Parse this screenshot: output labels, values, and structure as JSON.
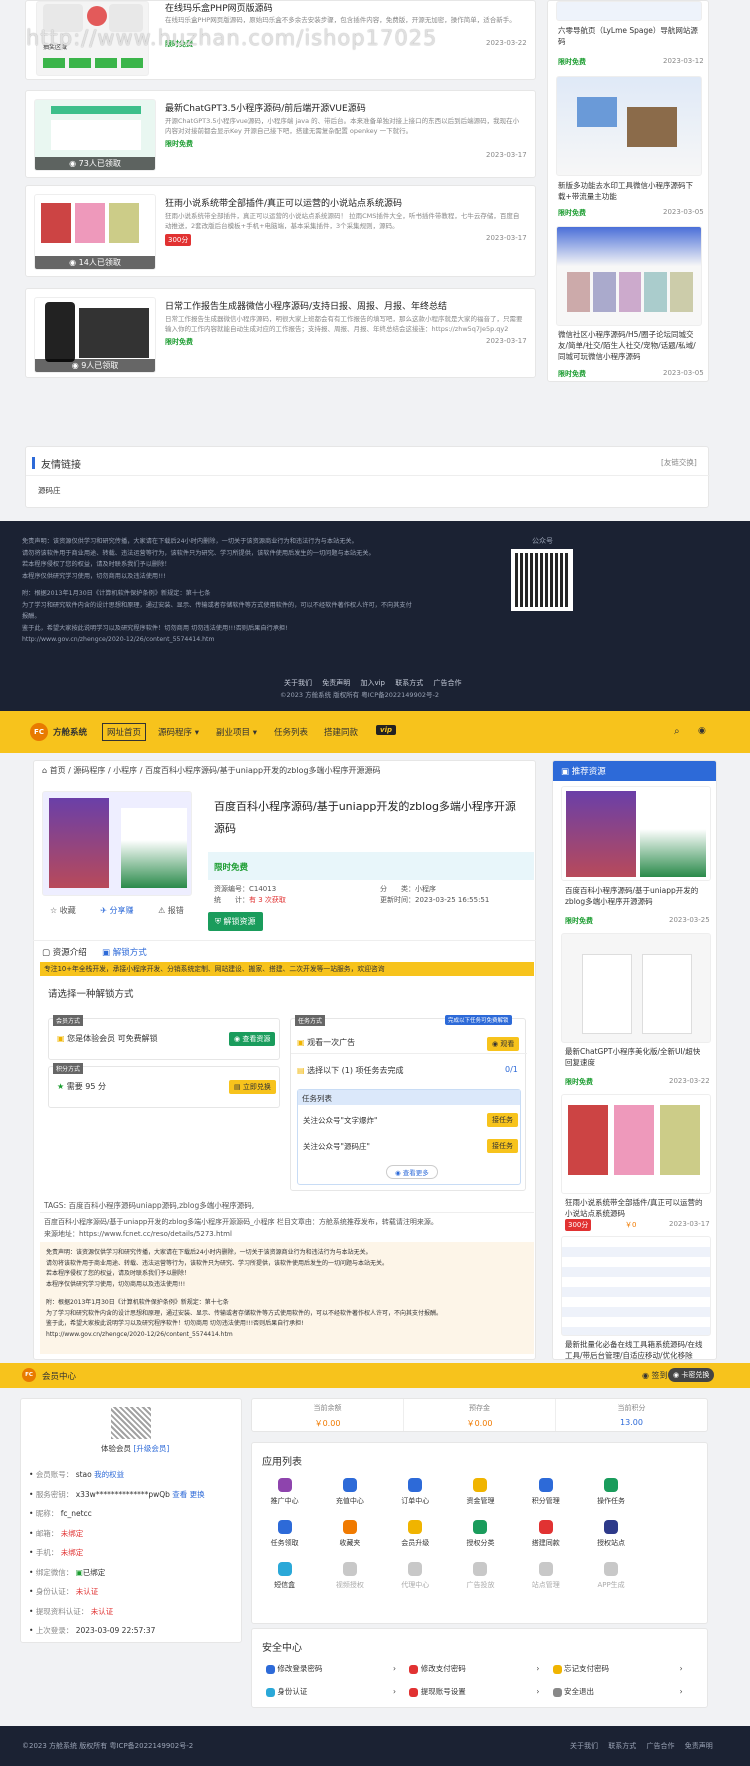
{
  "watermark": "http://www.huzhan.com/ishop17025",
  "top_list": [
    {
      "title": "在线玛乐盒PHP网页版源码",
      "desc": "在线玛乐盒PHP网页版源码，原始玛乐盒不多余去安装步骤，包含插件内容，免费版，开源无加密，操作简单，适合新手。",
      "price": "限时免费",
      "date": "2023-03-22",
      "count": "",
      "thumb_badge": "抽奖区域"
    },
    {
      "title": "最新ChatGPT3.5小程序源码/前后端开源VUE源码",
      "desc": "开源ChatGPT3.5小程序vue源码，小程序端 java 的、带后台。本来准备单独对接上接口的东西以后到后端源码，我现在小内容对对接前都会显示Key 开源自己接下吧，搭建无需复杂配置 openkey 一下就行。",
      "price": "限时免费",
      "date": "2023-03-17",
      "count": "73人已领取"
    },
    {
      "title": "狂雨小说系统带全部插件/真正可以运营的小说站点系统源码",
      "desc": "狂雨小说系统带全部插件，真正可以运营的小说站点系统源码！ 拉雨CMS插件大全，听书插件带教程，七牛云存储，百度自动推送，2套改版后台模板+手机+电脑端，基本采集插件，3个采集规则，源码。",
      "price": "300分",
      "date": "2023-03-17",
      "count": "14人已领取"
    },
    {
      "title": "日常工作报告生成器微信小程序源码/支持日报、周报、月报、年终总结",
      "desc": "日常工作报告生成器微信小程序源码，明很大家上班都会有有工作报告的填写吧，那么这款小程序就是大家的福音了，只需要输入你的工作内容就能自动生成对应的工作报告；支持报、周报、月报、年终总结会这接连：https://zhw5q7Je5p.qy2",
      "price": "限时免费",
      "date": "2023-03-17",
      "count": "9人已领取"
    }
  ],
  "right_list": [
    {
      "title": "六零导航页（LyLme Spage）导航网站源码",
      "price": "限时免费",
      "date": "2023-03-12"
    },
    {
      "title": "新版多功能去水印工具微信小程序源码下载+带流量主功能",
      "price": "限时免费",
      "date": "2023-03-05"
    },
    {
      "title": "微信社区小程序源码/H5/圈子论坛同城交友/简单/社交/陌生人社交/宠物/话题/私域/同城可玩微信小程序源码",
      "price": "限时免费",
      "date": "2023-03-05"
    }
  ],
  "friend_links": {
    "title": "友情链接",
    "more": "[友链交换]",
    "items": [
      "源码庄"
    ]
  },
  "footer1": {
    "disclaimer": [
      "免责声明：该资源仅供学习和研究传播，大家请在下载后24小时内删除，一切关于该资源商业行为和违法行为与本站无关。",
      "请勿将该软件用于商业用途、转载、违法运营等行为，该软件只为研究、学习所提供，该软件使用后发生的一切问题与本站无关。",
      "若本程序侵权了您的权益，请及时联系我们予以删除！",
      "本程序仅供研究学习使用，切勿商用以及违法使用!!!",
      "附：根据2013年1月30日《计算机软件保护条例》新规定：第十七条",
      "为了学习和研究软件内含的设计思想和原理，通过安装、显示、传输或者存储软件等方式使用软件的，可以不经软件著作权人许可，不向其支付报酬。",
      "鉴于此，希望大家按此说明学习以及研究程序软件！切勿商用 切勿违法使用!!!否则后果自行承担!",
      "http://www.gov.cn/zhengce/2020-12/26/content_5574414.htm"
    ],
    "qr_label": "公众号",
    "links": [
      "关于我们",
      "免责声明",
      "加入vip",
      "联系方式",
      "广告合作"
    ],
    "copyright": "©2023  方舱系统  版权所有  粤ICP备2022149902号-2"
  },
  "header": {
    "logo_text": "方舱系统",
    "nav": [
      "网址首页",
      "源码程序",
      "副业项目",
      "任务列表",
      "搭建同款"
    ],
    "vip": "vip"
  },
  "breadcrumb": "首页 / 源码程序 / 小程序 / 百度百科小程序源码/基于uniapp开发的zblog多端小程序开源源码",
  "product": {
    "title": "百度百科小程序源码/基于uniapp开发的zblog多端小程序开源源码",
    "price": "限时免费",
    "code_label": "资源编号：",
    "code": "C14013",
    "cat_label": "分　　类：",
    "cat": "小程序",
    "stat_label": "统　　计：",
    "stat": "有 3 次获取",
    "update_label": "更新时间：",
    "update": "2023-03-25 16:55:51",
    "fav": "收藏",
    "share": "分享赚",
    "report": "报错",
    "unlock": "解锁资源"
  },
  "tabs": [
    "资源介绍",
    "解锁方式"
  ],
  "notice_bar": "专注10+年全栈开发，承接小程序开发、分销系统定制、网站建设、搬家、搭建、二次开发等一站服务，欢迎咨询",
  "unlock": {
    "heading": "请选择一种解锁方式",
    "member_tag": "会员方式",
    "member_text": "您是体验会员 可免费解锁",
    "member_btn": "查看资源",
    "points_tag": "积分方式",
    "points_text": "需要 95 分",
    "points_btn": "立即兑换",
    "task_tag": "任务方式",
    "task_badge": "完成以下任务可免费解锁",
    "ad_text": "观看一次广告",
    "ad_btn": "观看",
    "choose_text": "选择以下 (1) 项任务去完成",
    "choose_count": "0/1",
    "task_list_title": "任务列表",
    "tasks": [
      {
        "text": "关注公众号\"文字爆炸\"",
        "btn": "接任务"
      },
      {
        "text": "关注公众号\"源码庄\"",
        "btn": "接任务"
      }
    ],
    "more": "查看更多"
  },
  "tags": "TAGS:  百度百科小程序源码uniapp源码,zblog多端小程序源码,",
  "source_line": "百度百科小程序源码/基于uniapp开发的zblog多端小程序开源源码_小程序 栏目文章由：方舱系统推荐发布，转载请注明来源。",
  "source_url": "来源地址：https://www.fcnet.cc/reso/details/5273.html",
  "sidebar_rec": {
    "title": "推荐资源",
    "items": [
      {
        "title": "百度百科小程序源码/基于uniapp开发的zblog多端小程序开源源码",
        "price": "限时免费",
        "date": "2023-03-25"
      },
      {
        "title": "最新ChatGPT小程序美化版/全新UI/超快回复速度",
        "price": "限时免费",
        "date": "2023-03-22"
      },
      {
        "title": "狂雨小说系统带全部插件/真正可以运营的小说站点系统源码",
        "price": "300分",
        "price2": "￥0",
        "date": "2023-03-17"
      },
      {
        "title": "最新批量化必备在线工具箱系统源码/在线工具/带后台管理/自适应移动/优化移除",
        "price": "",
        "date": ""
      }
    ]
  },
  "member": {
    "title": "会员中心",
    "sign": "签到",
    "redeem": "卡密兑换",
    "level": "体验会员",
    "upgrade": "[升级会员]",
    "fields": [
      {
        "k": "会员账号：",
        "v": "stao",
        "link": "我的权益"
      },
      {
        "k": "服务密钥：",
        "v": "x33w**************pwQb",
        "link": "查看 更换"
      },
      {
        "k": "昵称：",
        "v": "fc_netcc",
        "link": ""
      },
      {
        "k": "邮箱：",
        "v": "未绑定",
        "link": ""
      },
      {
        "k": "手机：",
        "v": "未绑定",
        "link": ""
      },
      {
        "k": "绑定微信：",
        "v": "已绑定",
        "link": ""
      },
      {
        "k": "身份认证：",
        "v": "未认证",
        "link": ""
      },
      {
        "k": "提现资料认证：",
        "v": "未认证",
        "link": ""
      },
      {
        "k": "上次登录：",
        "v": "2023-03-09 22:57:37",
        "link": ""
      }
    ],
    "stats": [
      {
        "k": "当前余额",
        "v": "￥0.00"
      },
      {
        "k": "预存金",
        "v": "￥0.00"
      },
      {
        "k": "当前积分",
        "v": "13.00"
      }
    ],
    "apps_title": "应用列表",
    "apps": [
      {
        "label": "推广中心",
        "color": "#8e44ad"
      },
      {
        "label": "充值中心",
        "color": "#2d6ad8"
      },
      {
        "label": "订单中心",
        "color": "#2d6ad8"
      },
      {
        "label": "资金管理",
        "color": "#f0b400"
      },
      {
        "label": "积分管理",
        "color": "#2d6ad8"
      },
      {
        "label": "操作任务",
        "color": "#1a9c5c"
      },
      {
        "label": "",
        "color": "transparent"
      },
      {
        "label": "任务领取",
        "color": "#2d6ad8"
      },
      {
        "label": "收藏夹",
        "color": "#f07a00"
      },
      {
        "label": "会员升级",
        "color": "#f0b400"
      },
      {
        "label": "授权分类",
        "color": "#1a9c5c"
      },
      {
        "label": "搭建同款",
        "color": "#e13232"
      },
      {
        "label": "授权站点",
        "color": "#2d3a8a"
      },
      {
        "label": "",
        "color": "transparent"
      },
      {
        "label": "短信盒",
        "color": "#2aa8d8"
      },
      {
        "label": "视频授权",
        "color": "#c8c8c8"
      },
      {
        "label": "代理中心",
        "color": "#c8c8c8"
      },
      {
        "label": "广告投放",
        "color": "#c8c8c8"
      },
      {
        "label": "站点管理",
        "color": "#c8c8c8"
      },
      {
        "label": "APP生成",
        "color": "#c8c8c8"
      },
      {
        "label": "",
        "color": "transparent"
      }
    ],
    "security_title": "安全中心",
    "security": [
      {
        "label": "修改登录密码",
        "color": "#2d6ad8"
      },
      {
        "label": "修改支付密码",
        "color": "#e13232"
      },
      {
        "label": "忘记支付密码",
        "color": "#f0b400"
      },
      {
        "label": "身份认证",
        "color": "#2aa8d8"
      },
      {
        "label": "提现账号设置",
        "color": "#e13232"
      },
      {
        "label": "安全退出",
        "color": "#888"
      }
    ]
  },
  "footer2": {
    "copyright": "©2023  方舱系统  版权所有  粤ICP备2022149902号-2",
    "links": [
      "关于我们",
      "联系方式",
      "广告合作",
      "免责声明"
    ]
  }
}
